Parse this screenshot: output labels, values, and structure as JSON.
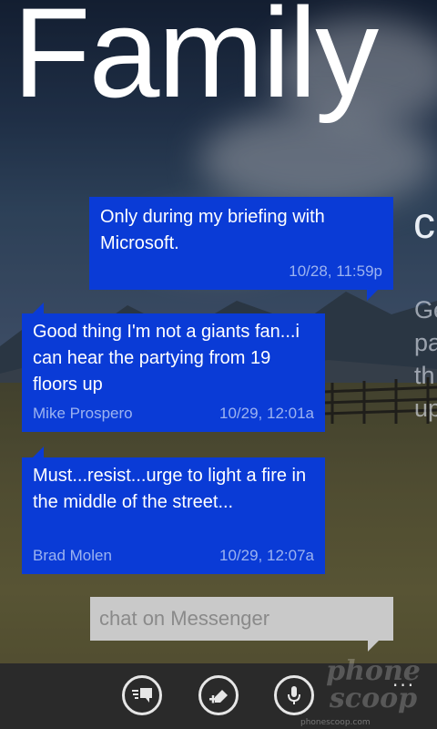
{
  "title": "Family",
  "messages": [
    {
      "text": "Only during my briefing with Microsoft.",
      "sender": "",
      "time": "10/28, 11:59p",
      "direction": "outgoing"
    },
    {
      "text": "Good thing I'm not a giants fan...i can hear the partying from 19 floors up",
      "sender": "Mike Prospero",
      "time": "10/29, 12:01a",
      "direction": "incoming"
    },
    {
      "text": "Must...resist...urge to light a fire in the middle of the street...",
      "sender": "Brad Molen",
      "time": "10/29, 12:07a",
      "direction": "incoming"
    }
  ],
  "next_pivot": {
    "initial": "c",
    "lines": [
      "Ge",
      "pa",
      "th",
      "up"
    ]
  },
  "composer": {
    "placeholder": "chat on Messenger"
  },
  "appbar": {
    "buttons": [
      "switch-chat-icon",
      "attach-icon",
      "microphone-icon"
    ],
    "more": "..."
  },
  "watermark": {
    "line1": "phone",
    "line2": "scoop",
    "small": "phonescoop.com"
  },
  "colors": {
    "bubble": "#0a3bd6",
    "meta_text": "#9cb3f0",
    "composer": "#c9c9c9",
    "appbar": "#2a2a2a"
  }
}
